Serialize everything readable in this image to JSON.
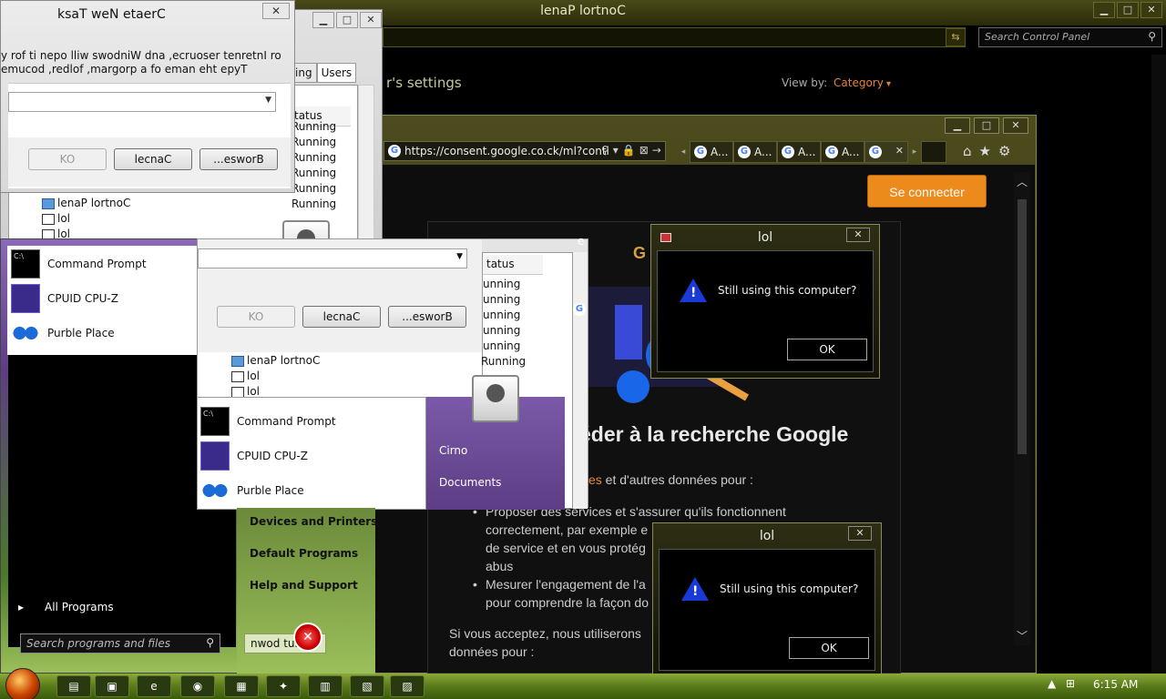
{
  "control_panel": {
    "title": "lenaP lortnoC",
    "search_placeholder": "Search Control Panel",
    "heading": "r's settings",
    "view_by_label": "View by:",
    "view_by_value": "Category"
  },
  "browser": {
    "url": "https://consent.google.co.ck/ml?conti",
    "tabs": [
      "A...",
      "A...",
      "A...",
      "A...",
      ""
    ],
    "se_connecter": "Se connecter",
    "google_g": "G",
    "heading": "éder à la recherche Google",
    "intro_prefix": "es",
    "intro_text": " et d'autres données pour :",
    "bullet1_line1": "Proposer des services et s'assurer qu'ils fonctionnent",
    "bullet1_line2": "correctement, par exemple e",
    "bullet1_line3": "de service et en vous protég",
    "bullet1_line4": "abus",
    "bullet2_line1": "Mesurer l'engagement de l'a",
    "bullet2_line2": "pour comprendre la façon do",
    "accept_line1": "Si vous acceptez, nous utiliserons",
    "accept_line2": "données pour :"
  },
  "task_dialog": {
    "title": "ksaT weN etaerC",
    "line1": "y rof ti nepo lliw swodniW dna ,ecruoser tenretnI ro",
    "line2": "emucod ,redlof ,margorp a fo eman eht epyT",
    "ok": "KO",
    "cancel": "lecnaC",
    "browse": "...esworB"
  },
  "task_manager": {
    "tab_partial": "ing",
    "tab_users": "Users",
    "status_header": "tatus",
    "statuses": [
      "Running",
      "Running",
      "Running",
      "Running",
      "Running",
      "Running"
    ],
    "app_control_panel": "lenaP lortnoC",
    "app_lol": "lol"
  },
  "ghost": {
    "status_header": "tatus",
    "statuses": [
      "unning",
      "unning",
      "unning",
      "unning",
      "unning"
    ],
    "running": "Running",
    "app_control_panel": "lenaP lortnoC",
    "app_lol": "lol",
    "ok": "KO",
    "cancel": "lecnaC",
    "browse": "...esworB",
    "letter_e": "e"
  },
  "start_menu": {
    "items": [
      "Command Prompt",
      "CPUID CPU-Z",
      "Purble Place"
    ],
    "all_programs": "All Programs",
    "search_placeholder": "Search programs and files",
    "right_items": [
      "Devices and Printers",
      "Default Programs",
      "Help and Support"
    ],
    "user_links": [
      "Cirno",
      "Documents"
    ],
    "shutdown": "nwod tuh"
  },
  "lol_dialogs": [
    {
      "title": "lol",
      "message": "Still using this computer?",
      "ok": "OK"
    },
    {
      "title": "lol",
      "message": "Still using this computer?",
      "ok": "OK"
    }
  ],
  "taskbar": {
    "clock": "6:15 AM"
  }
}
